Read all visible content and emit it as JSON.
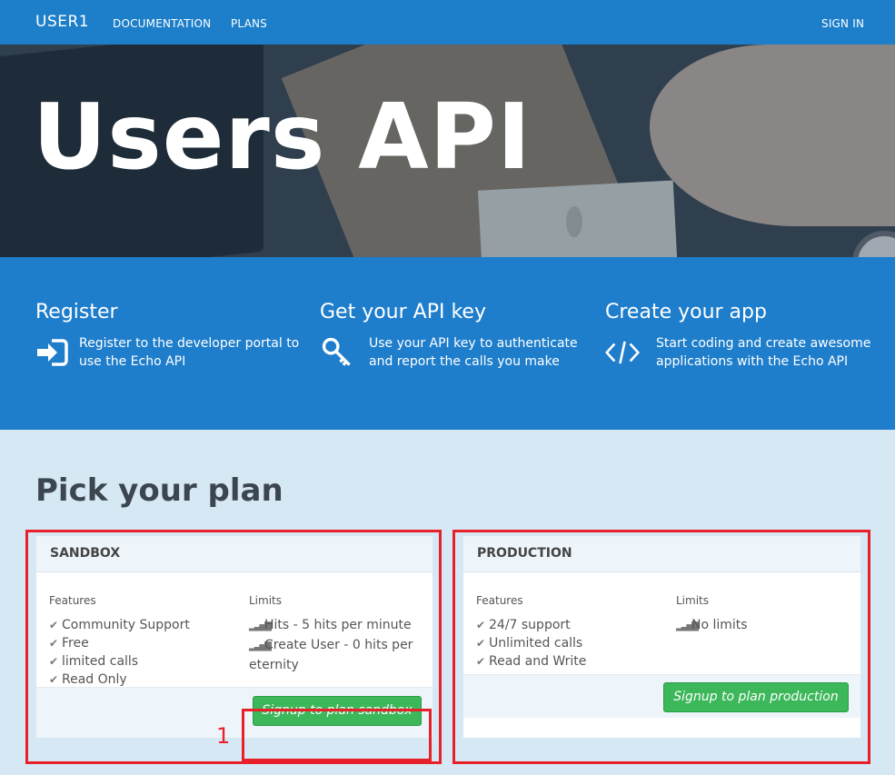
{
  "nav": {
    "brand": "USER1",
    "documentation": "DOCUMENTATION",
    "plans": "PLANS",
    "sign_in": "SIGN IN"
  },
  "hero": {
    "title": "Users API"
  },
  "steps": [
    {
      "title": "Register",
      "text": "Register to the developer portal to use the Echo API",
      "icon": "sign-in-icon"
    },
    {
      "title": "Get your API key",
      "text": "Use your API key to authenticate and report the calls you make",
      "icon": "key-icon"
    },
    {
      "title": "Create your app",
      "text": "Start coding and create awesome applications with the Echo API",
      "icon": "code-icon"
    }
  ],
  "plans_section": {
    "heading": "Pick your plan",
    "plans": [
      {
        "name": "SANDBOX",
        "features_label": "Features",
        "features": [
          "Community Support",
          "Free",
          "limited calls",
          "Read Only"
        ],
        "limits_label": "Limits",
        "limits": [
          "Hits - 5 hits per minute",
          "Create User - 0 hits per",
          "eternity"
        ],
        "button": "Signup to plan sandbox"
      },
      {
        "name": "PRODUCTION",
        "features_label": "Features",
        "features": [
          "24/7 support",
          "Unlimited calls",
          "Read and Write"
        ],
        "limits_label": "Limits",
        "limits": [
          "No limits"
        ],
        "button": "Signup to plan production"
      }
    ]
  },
  "annotation": {
    "marker": "1",
    "highlight_color": "#e8202a"
  },
  "colors": {
    "nav": "#1d7fc9",
    "steps_band": "#1f7ecb",
    "page_bg": "#d6e8f4",
    "button": "#3cb75a"
  }
}
